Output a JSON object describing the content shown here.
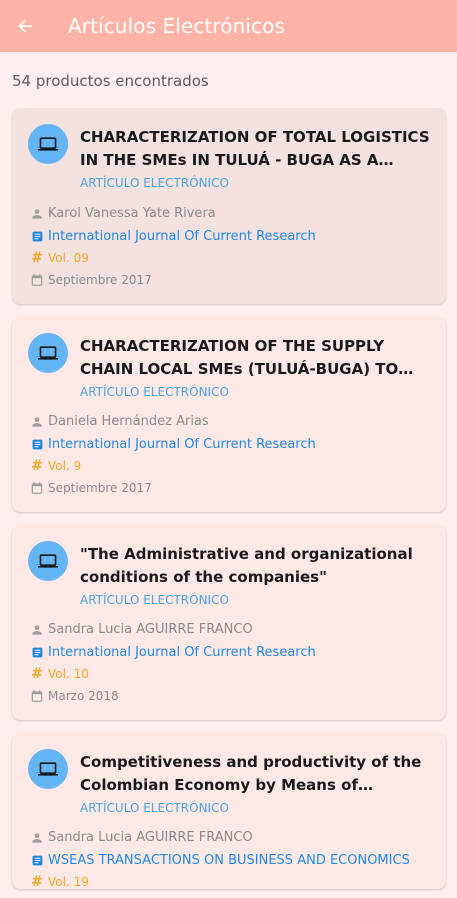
{
  "appbar": {
    "title": "Artículos Electrónicos"
  },
  "results": {
    "count_label": "54 productos encontrados"
  },
  "articles": [
    {
      "title": "CHARACTERIZATION OF TOTAL LOGISTICS IN THE SMEs IN TULUÁ - BUGA AS A FUNDA...",
      "type": "ARTÍCULO ELECTRÓNICO",
      "author": "Karol Vanessa Yate Rivera",
      "journal": "International Journal Of Current Research",
      "volume": "Vol. 09",
      "date": "Septiembre 2017"
    },
    {
      "title": "CHARACTERIZATION OF THE SUPPLY CHAIN LOCAL SMEs (TULUÁ-BUGA) TO FACE THE ...",
      "type": "ARTÍCULO ELECTRÓNICO",
      "author": "Daniela Hernández Arias",
      "journal": "International Journal Of Current Research",
      "volume": "Vol. 9",
      "date": "Septiembre 2017"
    },
    {
      "title": "\"The Administrative and organizational conditions of the companies\"",
      "type": "ARTÍCULO ELECTRÓNICO",
      "author": "Sandra Lucia AGUIRRE FRANCO",
      "journal": "International Journal Of Current Research",
      "volume": "Vol. 10",
      "date": "Marzo 2018"
    },
    {
      "title": "Competitiveness and productivity of the Colombian Economy by Means of Competit...",
      "type": "ARTÍCULO ELECTRÓNICO",
      "author": "Sandra Lucia AGUIRRE FRANCO",
      "journal": "WSEAS TRANSACTIONS ON BUSINESS AND ECONOMICS",
      "volume": "Vol. 19",
      "date": ""
    }
  ]
}
